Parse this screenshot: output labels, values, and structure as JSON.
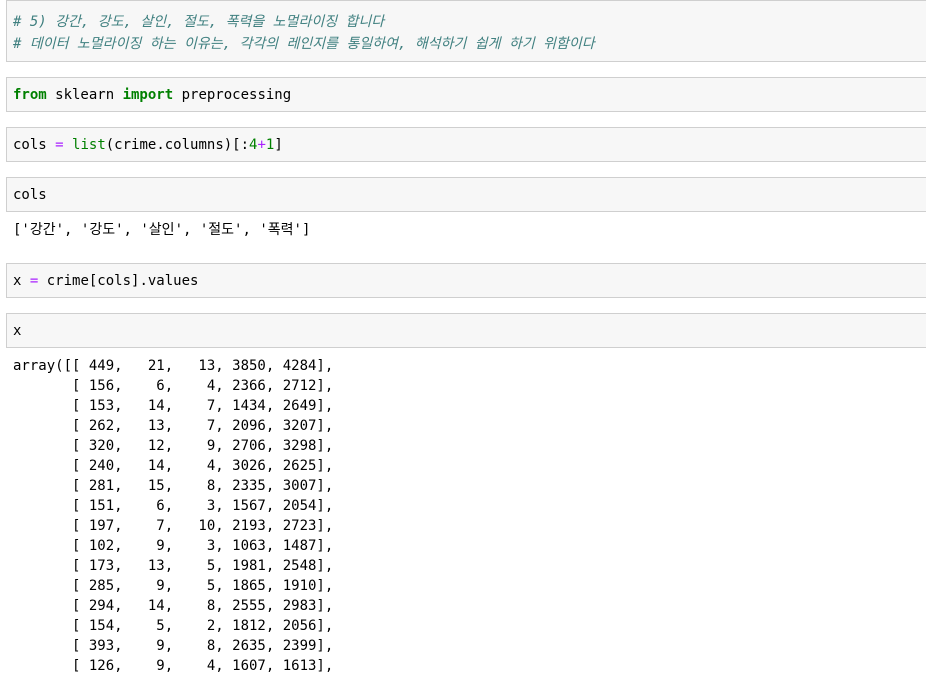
{
  "cells": {
    "c1_line1": "# 5) 강간, 강도, 살인, 절도, 폭력을 노멀라이징 합니다",
    "c1_line2": "# 데이터 노멀라이징 하는 이유는, 각각의 레인지를 통일하여, 해석하기 쉽게 하기 위함이다",
    "c2": {
      "kw1": "from",
      "mod": " sklearn ",
      "kw2": "import",
      "name": " preprocessing"
    },
    "c3": {
      "lhs": "cols ",
      "eq": "=",
      "sp": " ",
      "fn": "list",
      "a": "(crime.columns)[:",
      "n1": "4",
      "plus": "+",
      "n2": "1",
      "b": "]"
    },
    "c4": "cols",
    "out4": "['강간', '강도', '살인', '절도', '폭력']",
    "c5": {
      "lhs": "x ",
      "eq": "=",
      "rhs": " crime[cols].values"
    },
    "c6": "x"
  },
  "array_output": [
    "array([[ 449,   21,   13, 3850, 4284],",
    "       [ 156,    6,    4, 2366, 2712],",
    "       [ 153,   14,    7, 1434, 2649],",
    "       [ 262,   13,    7, 2096, 3207],",
    "       [ 320,   12,    9, 2706, 3298],",
    "       [ 240,   14,    4, 3026, 2625],",
    "       [ 281,   15,    8, 2335, 3007],",
    "       [ 151,    6,    3, 1567, 2054],",
    "       [ 197,    7,   10, 2193, 2723],",
    "       [ 102,    9,    3, 1063, 1487],",
    "       [ 173,   13,    5, 1981, 2548],",
    "       [ 285,    9,    5, 1865, 1910],",
    "       [ 294,   14,    8, 2555, 2983],",
    "       [ 154,    5,    2, 1812, 2056],",
    "       [ 393,    9,    8, 2635, 2399],",
    "       [ 126,    9,    4, 1607, 1613],"
  ]
}
